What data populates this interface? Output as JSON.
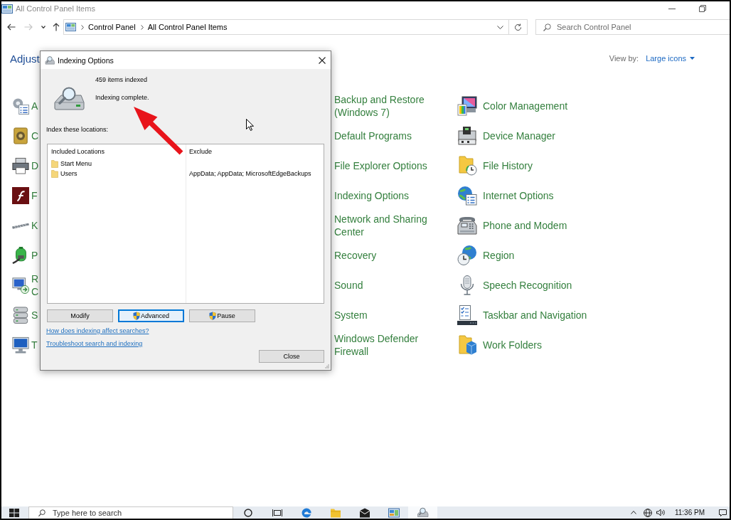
{
  "window": {
    "title": "All Control Panel Items"
  },
  "nav_buttons": [
    {
      "kind": "back",
      "disabled": false
    },
    {
      "kind": "forward",
      "disabled": true
    },
    {
      "kind": "recent",
      "disabled": false
    },
    {
      "kind": "up",
      "disabled": false
    }
  ],
  "address_bar": {
    "path": [
      "Control Panel",
      "All Control Panel Items"
    ]
  },
  "search": {
    "placeholder": "Search Control Panel"
  },
  "heading": "Adjust",
  "view_by": {
    "label": "View by:",
    "value": "Large icons"
  },
  "columns": [
    {
      "items": [
        {
          "label": "A"
        },
        {
          "label": "C"
        },
        {
          "label": "D"
        },
        {
          "label": "F"
        },
        {
          "label": "K"
        },
        {
          "label": "P"
        },
        {
          "label": "R C"
        },
        {
          "label": "S"
        },
        {
          "label": "T"
        }
      ]
    },
    {
      "items": [
        {
          "label": "Backup and Restore (Windows 7)"
        },
        {
          "label": "Default Programs"
        },
        {
          "label": "File Explorer Options"
        },
        {
          "label": "Indexing Options"
        },
        {
          "label": "Network and Sharing Center"
        },
        {
          "label": "Recovery"
        },
        {
          "label": "Sound"
        },
        {
          "label": "System"
        },
        {
          "label": "Windows Defender Firewall"
        }
      ]
    },
    {
      "items": [
        {
          "label": "Color Management"
        },
        {
          "label": "Device Manager"
        },
        {
          "label": "File History"
        },
        {
          "label": "Internet Options"
        },
        {
          "label": "Phone and Modem"
        },
        {
          "label": "Region"
        },
        {
          "label": "Speech Recognition"
        },
        {
          "label": "Taskbar and Navigation"
        },
        {
          "label": "Work Folders"
        }
      ]
    }
  ],
  "dialog": {
    "title": "Indexing Options",
    "items_indexed": "459 items indexed",
    "status": "Indexing complete.",
    "locations_label": "Index these locations:",
    "columns": [
      "Included Locations",
      "Exclude"
    ],
    "locations": [
      {
        "name": "Start Menu"
      },
      {
        "name": "Users",
        "exclude": "AppData; AppData; MicrosoftEdgeBackups"
      }
    ],
    "buttons": [
      {
        "label": "Modify",
        "elevated": false,
        "focused": false
      },
      {
        "label": "Advanced",
        "elevated": true,
        "focused": true
      },
      {
        "label": "Pause",
        "elevated": true,
        "focused": false
      }
    ],
    "links": [
      "How does indexing affect searches?",
      "Troubleshoot search and indexing"
    ],
    "close_button": "Close"
  },
  "taskbar": {
    "search_placeholder": "Type here to search",
    "apps": [
      {
        "active": false
      },
      {
        "active": false
      },
      {
        "active": false
      },
      {
        "active": false
      },
      {
        "active": true
      }
    ],
    "time": "11:36 PM"
  }
}
